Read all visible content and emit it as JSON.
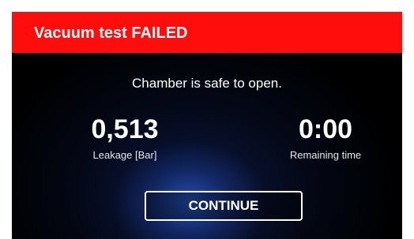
{
  "header": {
    "title": "Vacuum test FAILED"
  },
  "main": {
    "message": "Chamber is safe to open.",
    "leakage": {
      "value": "0,513",
      "label": "Leakage [Bar]"
    },
    "remaining_time": {
      "value": "0:00",
      "label": "Remaining time"
    },
    "continue_label": "CONTINUE"
  },
  "colors": {
    "header_background": "#ff0c0c",
    "screen_background": "#000000",
    "text": "#ffffff",
    "glow": "#2a5ac8"
  }
}
